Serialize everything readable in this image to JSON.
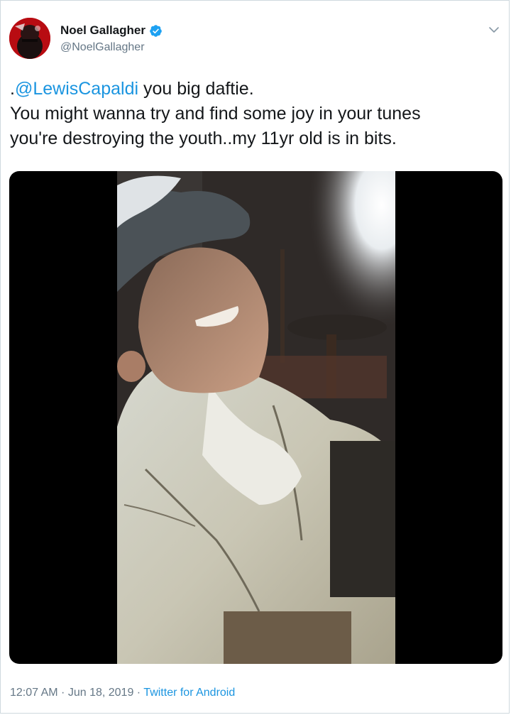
{
  "tweet": {
    "author": {
      "display_name": "Noel Gallagher",
      "handle": "@NoelGallagher",
      "verified": true,
      "avatar_icon": "profile-avatar"
    },
    "menu_icon": "chevron-down-icon",
    "text": {
      "line1_prefix": ".",
      "mention": "@LewisCapaldi",
      "line1_suffix": " you big daftie.",
      "line2": "You might wanna try and find some joy in your tunes",
      "line3": "you're destroying the youth..my 11yr old is in bits."
    },
    "media": {
      "type": "video"
    },
    "meta": {
      "time": "12:07 AM",
      "separator1": " · ",
      "date": "Jun 18, 2019",
      "separator2": " · ",
      "source": "Twitter for Android"
    }
  },
  "colors": {
    "link": "#1b95e0",
    "secondary_text": "#657786",
    "verified_badge": "#1da1f2",
    "border": "#cfd9de"
  }
}
